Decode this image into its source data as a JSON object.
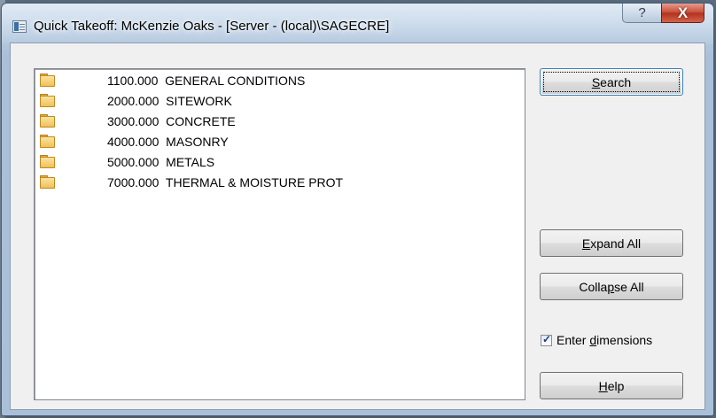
{
  "window": {
    "title": "Quick Takeoff:  McKenzie Oaks - [Server - (local)\\SAGECRE]",
    "help_glyph": "?",
    "close_glyph": "X"
  },
  "tree": {
    "items": [
      {
        "label": "1100.000  GENERAL CONDITIONS",
        "icon": "folder-icon"
      },
      {
        "label": "2000.000  SITEWORK",
        "icon": "folder-icon"
      },
      {
        "label": "3000.000  CONCRETE",
        "icon": "folder-icon"
      },
      {
        "label": "4000.000  MASONRY",
        "icon": "folder-icon"
      },
      {
        "label": "5000.000  METALS",
        "icon": "folder-icon"
      },
      {
        "label": "7000.000  THERMAL & MOISTURE PROT",
        "icon": "folder-icon"
      }
    ]
  },
  "buttons": {
    "search": {
      "pre": "",
      "key": "S",
      "post": "earch"
    },
    "expand_all": {
      "pre": "",
      "key": "E",
      "post": "xpand All"
    },
    "collapse_all": {
      "pre": "Colla",
      "key": "p",
      "post": "se All"
    },
    "help": {
      "pre": "",
      "key": "H",
      "post": "elp"
    }
  },
  "enter_dimensions": {
    "checked": true,
    "check_glyph": "✓",
    "pre": "Enter ",
    "key": "d",
    "post": "imensions"
  },
  "colors": {
    "folder": "#f0c15a",
    "close_button": "#c44b35",
    "default_button_border": "#3c7fb1"
  }
}
